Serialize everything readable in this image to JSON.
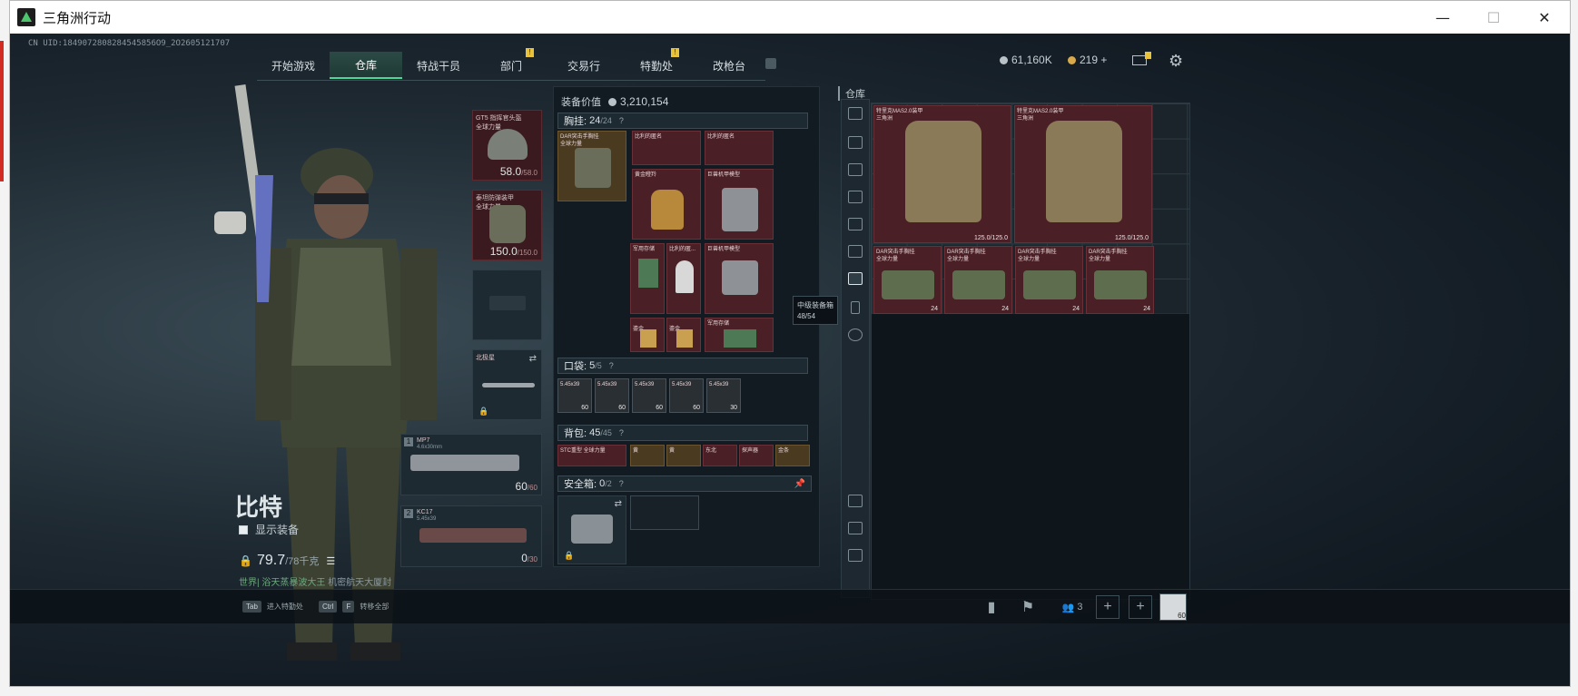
{
  "window": {
    "title": "三角洲行动",
    "controls": [
      "—",
      "☐",
      "✕"
    ]
  },
  "uid": "CN UID:1849072808284545856O9_2O2605121707",
  "nav": {
    "tabs": [
      {
        "label": "开始游戏",
        "active": false,
        "badge": ""
      },
      {
        "label": "仓库",
        "active": true,
        "badge": ""
      },
      {
        "label": "特战干员",
        "active": false,
        "badge": ""
      },
      {
        "label": "部门",
        "active": false,
        "badge": "!"
      },
      {
        "label": "交易行",
        "active": false,
        "badge": ""
      },
      {
        "label": "特勤处",
        "active": false,
        "badge": "!"
      },
      {
        "label": "改枪台",
        "active": false,
        "badge": ""
      }
    ]
  },
  "currency": {
    "silver": "61,160K",
    "gold": "219",
    "plus": "+"
  },
  "operator": {
    "name": "比特",
    "show_gear_label": "显示装备",
    "weight": "79.7",
    "weight_max": "/78千克",
    "world_msg_prefix": "世界| 浴天蒸暴波大王",
    "world_msg_suffix": "机密航天大厦封"
  },
  "gear": {
    "helmet": {
      "label": "GT5 指挥官头盔\n全球力量",
      "value": "58.0",
      "max": "/58.0"
    },
    "armor": {
      "label": "泰坦防弹装甲\n全球力量",
      "value": "150.0",
      "max": "/150.0"
    },
    "melee": {
      "label": "北极星"
    },
    "primary1": {
      "slot": "1",
      "label": "MP7",
      "sub": "4.6x30mm",
      "ammo": "60",
      "ammo_max": "/60"
    },
    "primary2": {
      "slot": "2",
      "label": "KC17",
      "sub": "5.45x39",
      "ammo": "0",
      "ammo_max": "/30"
    }
  },
  "inventory": {
    "value_label": "装备价值",
    "value": "3,210,154",
    "chest": {
      "label": "胸挂:",
      "count": "24",
      "max": "/24",
      "q": "?"
    },
    "chest_rig": {
      "label": "DAR突击手胸挂\n全球力量"
    },
    "chest_items": [
      {
        "label": "比利的匿名",
        "style": "red"
      },
      {
        "label": "比利的匿名",
        "style": "red"
      },
      {
        "label": "黄金瞪羚",
        "style": "red"
      },
      {
        "label": "巨兽机甲模型",
        "style": "red"
      },
      {
        "label": "军用存储",
        "style": "red"
      },
      {
        "label": "比利的匿...",
        "style": "red"
      },
      {
        "label": "巨兽机甲模型",
        "style": "red"
      },
      {
        "label": "鎏金",
        "style": "red"
      },
      {
        "label": "鎏金",
        "style": "red"
      },
      {
        "label": "军用存储",
        "style": "red"
      }
    ],
    "pockets": {
      "label": "口袋:",
      "count": "5",
      "max": "/5",
      "q": "?",
      "items": [
        {
          "label": "5.45x39",
          "count": "60"
        },
        {
          "label": "5.45x39",
          "count": "60"
        },
        {
          "label": "5.45x39",
          "count": "60"
        },
        {
          "label": "5.45x39",
          "count": "60"
        },
        {
          "label": "5.45x39",
          "count": "30"
        }
      ]
    },
    "backpack": {
      "label": "背包:",
      "count": "45",
      "max": "/45",
      "q": "?",
      "items": [
        {
          "label": "STC重型 全球力量"
        },
        {
          "label": "黄"
        },
        {
          "label": "黄"
        },
        {
          "label": "东北"
        },
        {
          "label": "探声器"
        },
        {
          "label": "金条"
        }
      ]
    },
    "safe": {
      "label": "安全箱:",
      "count": "0",
      "max": "/2",
      "q": "?"
    }
  },
  "tooltip": {
    "title": "中级装备箱",
    "value": "48/54"
  },
  "stash": {
    "label": "仓库",
    "armors": [
      {
        "label": "特里克MAS2.0装甲\n三角洲",
        "value": "125.0/125.0"
      },
      {
        "label": "特里克MAS2.0装甲\n三角洲",
        "value": "125.0/125.0"
      }
    ],
    "rigs": [
      {
        "label": "DAR突击手胸挂\n全球力量",
        "count": "24"
      },
      {
        "label": "DAR突击手胸挂\n全球力量",
        "count": "24"
      },
      {
        "label": "DAR突击手胸挂\n全球力量",
        "count": "24"
      },
      {
        "label": "DAR突击手胸挂\n全球力量",
        "count": "24"
      }
    ]
  },
  "bottom": {
    "hint1_key": "Tab",
    "hint1": "进入特勤处",
    "hint2_key": "Ctrl",
    "hint2_key2": "F",
    "hint2": "转移全部",
    "squad_count": "3",
    "avatar_level": "60"
  }
}
